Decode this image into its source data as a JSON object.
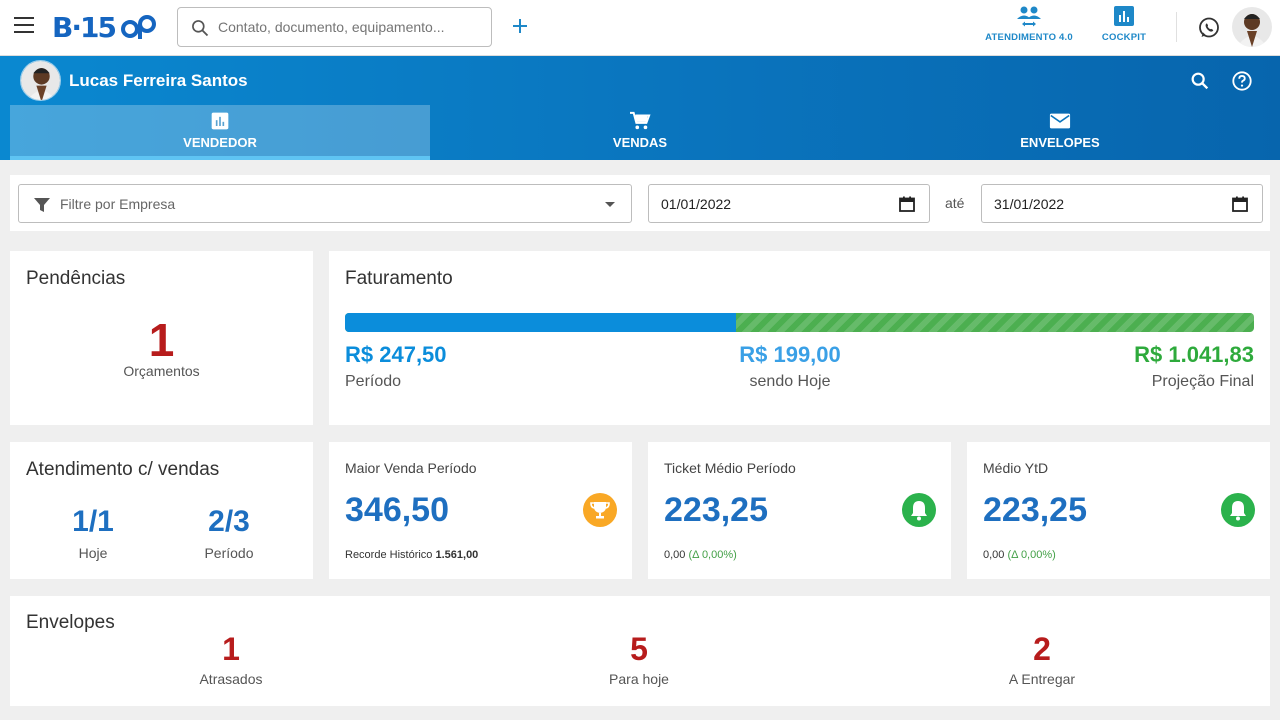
{
  "app": {
    "search_placeholder": "Contato, documento, equipamento...",
    "actions": [
      {
        "label": "ATENDIMENTO 4.0",
        "icon": "people-icon"
      },
      {
        "label": "COCKPIT",
        "icon": "bar-chart-icon"
      }
    ]
  },
  "user": {
    "name": "Lucas Ferreira Santos"
  },
  "tabs": [
    {
      "label": "VENDEDOR",
      "icon": "bar-chart-icon",
      "active": true
    },
    {
      "label": "VENDAS",
      "icon": "cart-icon",
      "active": false
    },
    {
      "label": "ENVELOPES",
      "icon": "mail-icon",
      "active": false
    }
  ],
  "filters": {
    "company_placeholder": "Filtre por Empresa",
    "date_from": "01/01/2022",
    "date_separator": "até",
    "date_to": "31/01/2022"
  },
  "pendencias": {
    "title": "Pendências",
    "value": "1",
    "label": "Orçamentos"
  },
  "faturamento": {
    "title": "Faturamento",
    "period_value": "R$ 247,50",
    "period_label": "Período",
    "today_value": "R$ 199,00",
    "today_label": "sendo Hoje",
    "projection_value": "R$ 1.041,83",
    "projection_label": "Projeção Final",
    "progress_fraction": 0.43
  },
  "atendimento": {
    "title": "Atendimento c/ vendas",
    "today_value": "1/1",
    "today_label": "Hoje",
    "period_value": "2/3",
    "period_label": "Período"
  },
  "stats": [
    {
      "title": "Maior Venda Período",
      "value": "346,50",
      "foot_label": "Recorde Histórico ",
      "foot_value": "1.561,00",
      "icon": "trophy-icon",
      "icon_color": "#f9a825"
    },
    {
      "title": "Ticket Médio Período",
      "value": "223,25",
      "foot_value": "0,00",
      "foot_delta": "(Δ 0,00%)",
      "icon": "bell-icon",
      "icon_color": "#2bb24c"
    },
    {
      "title": "Médio YtD",
      "value": "223,25",
      "foot_value": "0,00",
      "foot_delta": "(Δ 0,00%)",
      "icon": "bell-icon",
      "icon_color": "#2bb24c"
    }
  ],
  "envelopes": {
    "title": "Envelopes",
    "items": [
      {
        "value": "1",
        "label": "Atrasados"
      },
      {
        "value": "5",
        "label": "Para hoje"
      },
      {
        "value": "2",
        "label": "A Entregar"
      }
    ]
  }
}
